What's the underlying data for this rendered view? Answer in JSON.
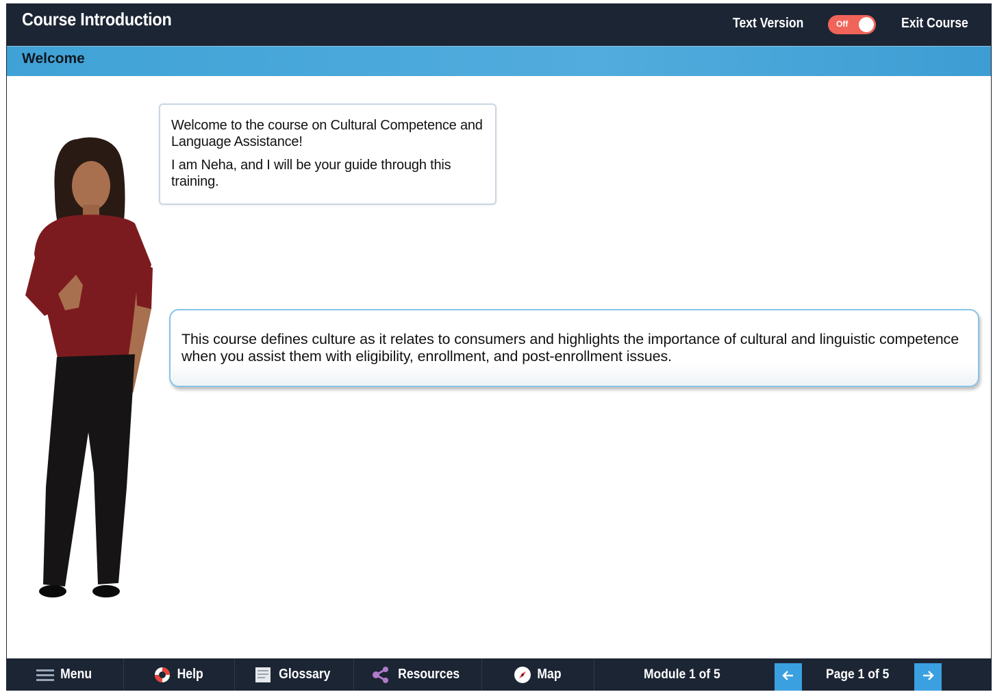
{
  "header": {
    "title": "Course Introduction",
    "text_version_label": "Text Version",
    "toggle_state": "Off",
    "exit_label": "Exit Course"
  },
  "section": {
    "title": "Welcome"
  },
  "speech_bubble": {
    "line1": "Welcome to the course on Cultural Competence and Language Assistance!",
    "line2": "I am Neha, and I will be your guide through this training."
  },
  "info_box": {
    "text": "This course defines culture as it relates to consumers and highlights the importance of cultural and linguistic competence when you assist them with eligibility, enrollment, and post-enrollment issues."
  },
  "footer": {
    "menu_label": "Menu",
    "help_label": "Help",
    "glossary_label": "Glossary",
    "resources_label": "Resources",
    "map_label": "Map",
    "module_status": "Module 1 of 5",
    "page_status": "Page 1 of 5"
  },
  "icons": {
    "menu": "hamburger-icon",
    "help": "lifebuoy-icon",
    "glossary": "book-icon",
    "resources": "share-icon",
    "map": "compass-icon",
    "prev": "arrow-left-icon",
    "next": "arrow-right-icon"
  },
  "colors": {
    "header_bg": "#1c2534",
    "section_bar": "#4aa8db",
    "toggle_off": "#f0645a",
    "nav_arrow": "#3aa0e0",
    "info_border": "#86c3e8"
  }
}
